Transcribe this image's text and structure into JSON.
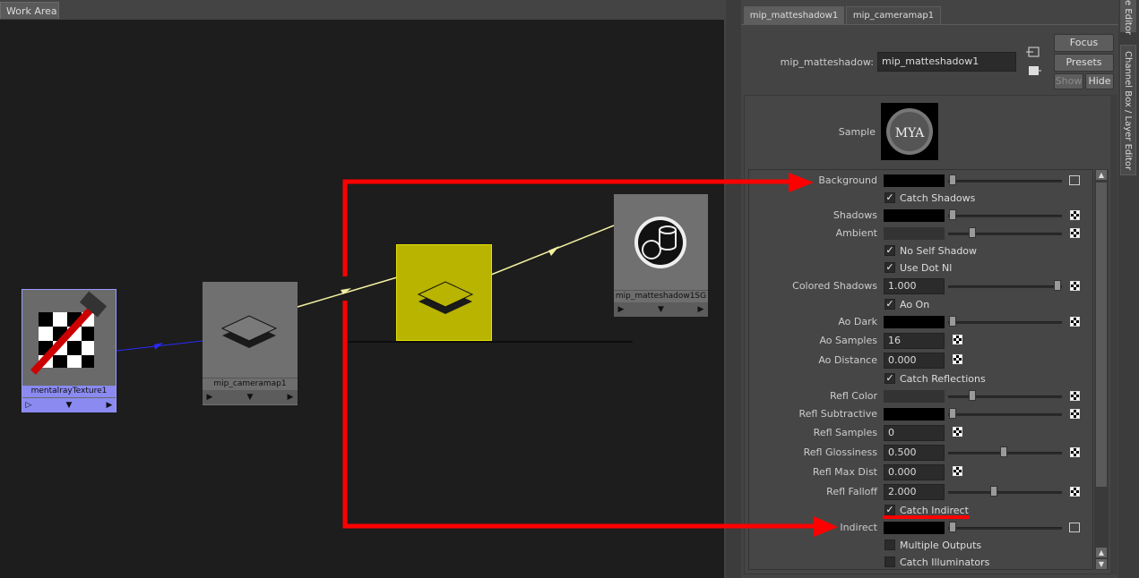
{
  "work_area": {
    "tab_label": "Work Area",
    "nodes": {
      "texture": {
        "label": "mentalrayTexture1"
      },
      "cameramap": {
        "label": "mip_cameramap1"
      },
      "middle": {
        "label": ""
      },
      "shading_group": {
        "label": "mip_matteshadow1SG"
      }
    }
  },
  "attribute_editor": {
    "tabs": [
      "mip_matteshadow1",
      "mip_cameramap1"
    ],
    "node_label": "mip_matteshadow:",
    "node_name": "mip_matteshadow1",
    "buttons": {
      "focus": "Focus",
      "presets": "Presets",
      "show": "Show",
      "hide": "Hide"
    },
    "sample_label": "Sample",
    "attrs": {
      "background": "Background",
      "catch_shadows": "Catch Shadows",
      "shadows": "Shadows",
      "ambient": "Ambient",
      "no_self_shadow": "No Self Shadow",
      "use_dot_nl": "Use Dot Nl",
      "colored_shadows": "Colored Shadows",
      "colored_shadows_value": "1.000",
      "ao_on": "Ao On",
      "ao_dark": "Ao Dark",
      "ao_samples": "Ao Samples",
      "ao_samples_value": "16",
      "ao_distance": "Ao Distance",
      "ao_distance_value": "0.000",
      "catch_reflections": "Catch Reflections",
      "refl_color": "Refl Color",
      "refl_subtractive": "Refl Subtractive",
      "refl_samples": "Refl Samples",
      "refl_samples_value": "0",
      "refl_glossiness": "Refl Glossiness",
      "refl_glossiness_value": "0.500",
      "refl_max_dist": "Refl Max Dist",
      "refl_max_dist_value": "0.000",
      "refl_falloff": "Refl Falloff",
      "refl_falloff_value": "2.000",
      "catch_indirect": "Catch Indirect",
      "indirect": "Indirect",
      "multiple_outputs": "Multiple Outputs",
      "catch_illuminators": "Catch Illuminators"
    }
  },
  "side_tabs": {
    "top": "e Editor",
    "channel_box": "Channel Box / Layer Editor"
  },
  "colors": {
    "annotation": "#ff0000",
    "connection_yellow": "#f2f0a0",
    "connection_blue": "#2a2aff",
    "selected_node": "#b8b400"
  }
}
